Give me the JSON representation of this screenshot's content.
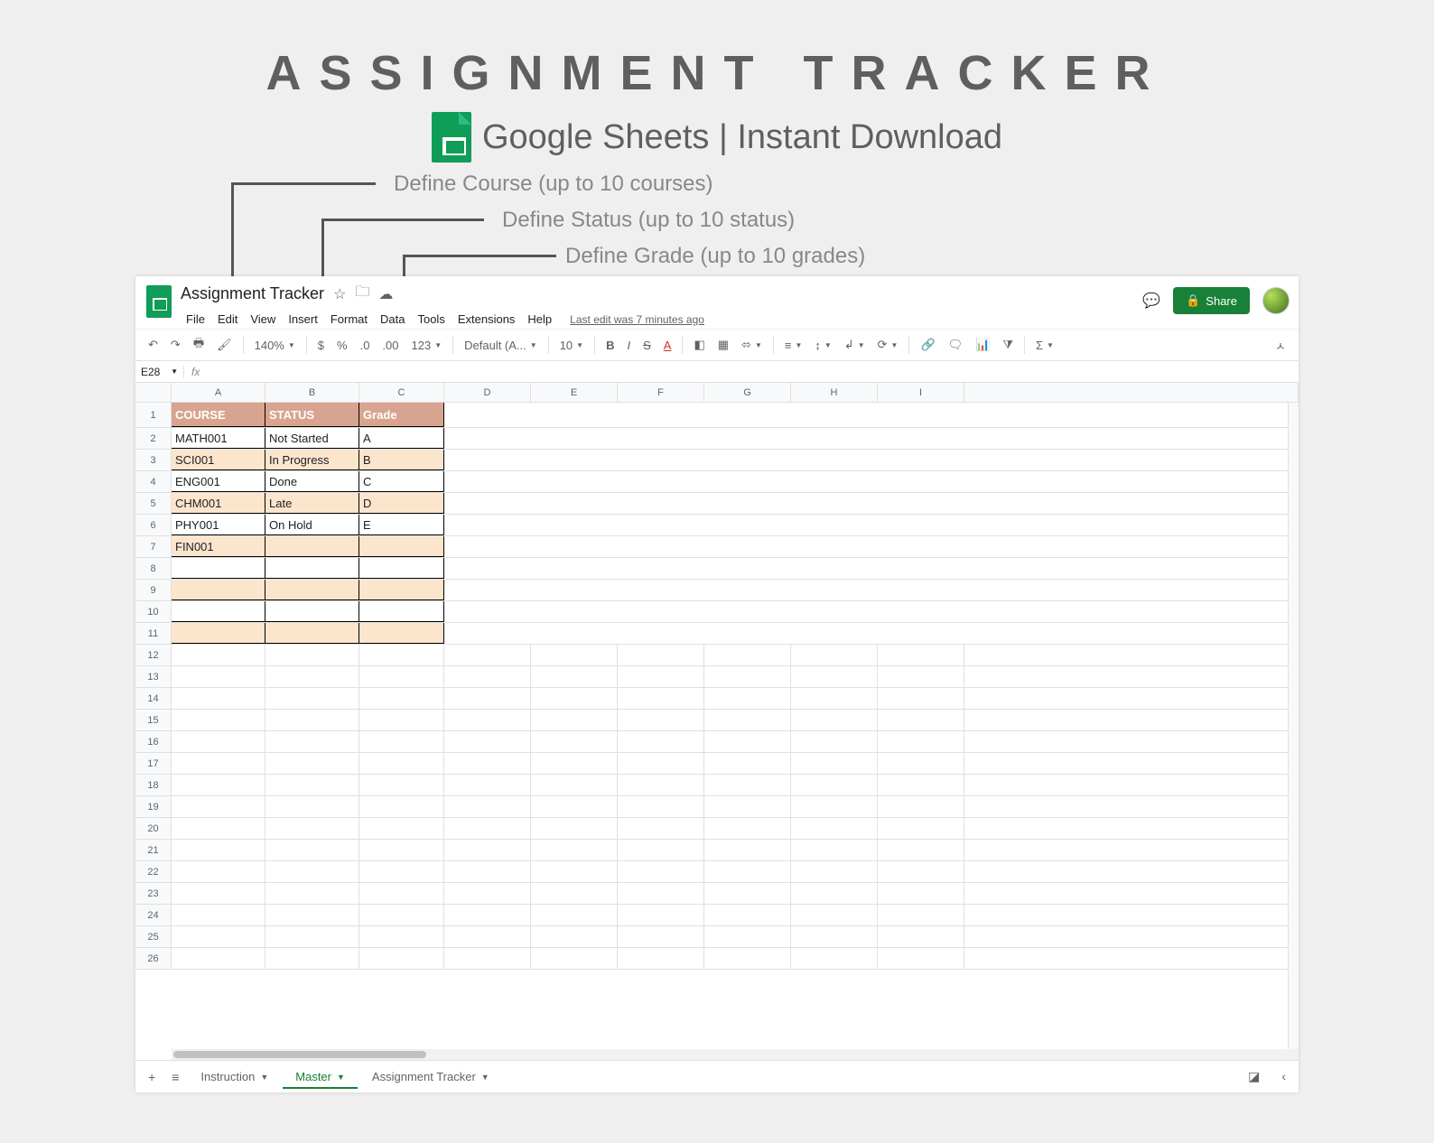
{
  "promo": {
    "title": "ASSIGNMENT TRACKER",
    "subtitle": "Google Sheets | Instant Download",
    "callout_course": "Define Course  (up to 10 courses)",
    "callout_status": "Define Status  (up to 10 status)",
    "callout_grade": "Define Grade (up to 10 grades)"
  },
  "document": {
    "title": "Assignment Tracker",
    "last_edit": "Last edit was 7 minutes ago"
  },
  "menu": {
    "file": "File",
    "edit": "Edit",
    "view": "View",
    "insert": "Insert",
    "format": "Format",
    "data": "Data",
    "tools": "Tools",
    "extensions": "Extensions",
    "help": "Help"
  },
  "share_label": "Share",
  "toolbar": {
    "zoom": "140%",
    "currency": "$",
    "percent": "%",
    "dec_dec": ".0",
    "dec_inc": ".00",
    "num_format": "123",
    "font": "Default (A...",
    "font_size": "10"
  },
  "namebox": "E28",
  "columns": [
    "A",
    "B",
    "C",
    "D",
    "E",
    "F",
    "G",
    "H",
    "I"
  ],
  "table": {
    "headers": {
      "course": "COURSE",
      "status": "STATUS",
      "grade": "Grade"
    },
    "rows": [
      {
        "course": "MATH001",
        "status": "Not Started",
        "grade": "A"
      },
      {
        "course": "SCI001",
        "status": "In Progress",
        "grade": "B"
      },
      {
        "course": "ENG001",
        "status": "Done",
        "grade": "C"
      },
      {
        "course": "CHM001",
        "status": "Late",
        "grade": "D"
      },
      {
        "course": "PHY001",
        "status": "On Hold",
        "grade": "E"
      },
      {
        "course": "FIN001",
        "status": "",
        "grade": ""
      },
      {
        "course": "",
        "status": "",
        "grade": ""
      },
      {
        "course": "",
        "status": "",
        "grade": ""
      },
      {
        "course": "",
        "status": "",
        "grade": ""
      },
      {
        "course": "",
        "status": "",
        "grade": ""
      }
    ]
  },
  "tabs": {
    "instruction": "Instruction",
    "master": "Master",
    "assignment": "Assignment Tracker"
  }
}
